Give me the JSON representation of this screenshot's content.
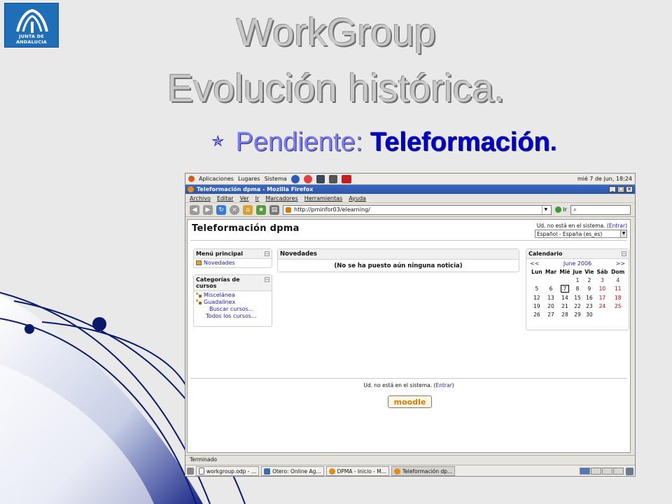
{
  "slide": {
    "logo_text": "JUNTA DE ANDALUCIA",
    "title_line1": "WorkGroup",
    "title_line2": "Evolución histórica.",
    "bullet_prefix": "Pendiente: ",
    "bullet_bold": "Teleformación",
    "bullet_end": "."
  },
  "gnome_panel": {
    "apps": "Aplicaciones",
    "places": "Lugares",
    "system": "Sistema",
    "clock": "mié  7 de jun, 18:24"
  },
  "firefox": {
    "window_title": "Teleformación dpma - Mozilla Firefox",
    "menu": [
      "Archivo",
      "Editar",
      "Ver",
      "Ir",
      "Marcadores",
      "Herramientas",
      "Ayuda"
    ],
    "url": "http://pminfor03/elearning/",
    "go_label": "Ir",
    "status": "Terminado"
  },
  "moodle": {
    "site_name": "Teleformación dpma",
    "login_prefix": "Ud. no está en el sistema. (",
    "login_link": "Entrar",
    "login_suffix": ")",
    "language": "Español - España (es_es)",
    "main_menu": {
      "title": "Menú principal",
      "item": "Novedades"
    },
    "categories": {
      "title": "Categorías de cursos",
      "items": [
        "Miscelánea",
        "Guadalinex"
      ],
      "search": "Buscar cursos...",
      "all": "Todos los cursos..."
    },
    "news": {
      "title": "Novedades",
      "empty": "(No se ha puesto aún ninguna noticia)"
    },
    "calendar": {
      "title": "Calendario",
      "prev": "<<",
      "month": "June 2006",
      "next": ">>",
      "days": [
        "Lun",
        "Mar",
        "Mié",
        "Jue",
        "Vie",
        "Sáb",
        "Dom"
      ],
      "weeks": [
        [
          "",
          "",
          "",
          "1",
          "2",
          "3",
          "4"
        ],
        [
          "5",
          "6",
          "7",
          "8",
          "9",
          "10",
          "11"
        ],
        [
          "12",
          "13",
          "14",
          "15",
          "16",
          "17",
          "18"
        ],
        [
          "19",
          "20",
          "21",
          "22",
          "23",
          "24",
          "25"
        ],
        [
          "26",
          "27",
          "28",
          "29",
          "30",
          "",
          ""
        ]
      ],
      "today": "7"
    },
    "footer_logo": "moodle"
  },
  "taskbar": {
    "items": [
      "workgroup.odp - ...",
      "Otero: Online Ag...",
      "DPMA - Inicio - M...",
      "Teleformación dp..."
    ]
  },
  "colors": {
    "title_gray": "#c8c8c8",
    "bullet_blue": "#0000cc",
    "link_blue": "#2222aa",
    "weekend_red": "#d00000",
    "ff_titlebar": "#3b69c1"
  }
}
